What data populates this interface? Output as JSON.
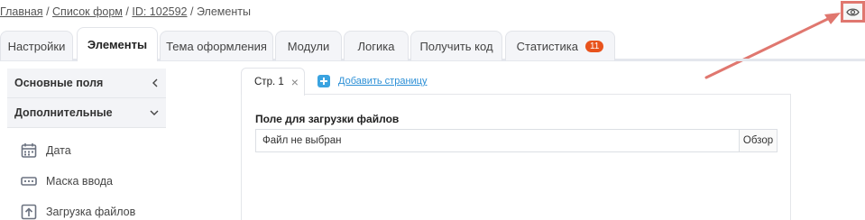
{
  "breadcrumb": {
    "home": "Главная",
    "forms": "Список форм",
    "id": "ID: 102592",
    "current": "Элементы",
    "separator": "/"
  },
  "preview_icon": "eye-icon",
  "tabs": [
    {
      "label": "Настройки",
      "active": false
    },
    {
      "label": "Элементы",
      "active": true
    },
    {
      "label": "Тема оформления",
      "active": false
    },
    {
      "label": "Модули",
      "active": false
    },
    {
      "label": "Логика",
      "active": false
    },
    {
      "label": "Получить код",
      "active": false
    },
    {
      "label": "Статистика",
      "active": false,
      "badge": "11"
    }
  ],
  "sidebar": {
    "sections": [
      {
        "label": "Основные поля",
        "icon": "chevron-left-icon"
      },
      {
        "label": "Дополнительные",
        "icon": "chevron-down-icon"
      }
    ],
    "items": [
      {
        "label": "Дата",
        "icon": "calendar-icon"
      },
      {
        "label": "Маска ввода",
        "icon": "input-mask-icon"
      },
      {
        "label": "Загрузка файлов",
        "icon": "upload-icon"
      }
    ]
  },
  "page_tabs": {
    "page_label": "Стр. 1",
    "close": "×",
    "add_page": "Добавить страницу"
  },
  "form": {
    "field_label": "Поле для загрузки файлов",
    "file_status": "Файл не выбран",
    "browse": "Обзор"
  },
  "colors": {
    "highlight": "#e0776f",
    "accent": "#3aa3e0",
    "badge": "#e8531d"
  }
}
